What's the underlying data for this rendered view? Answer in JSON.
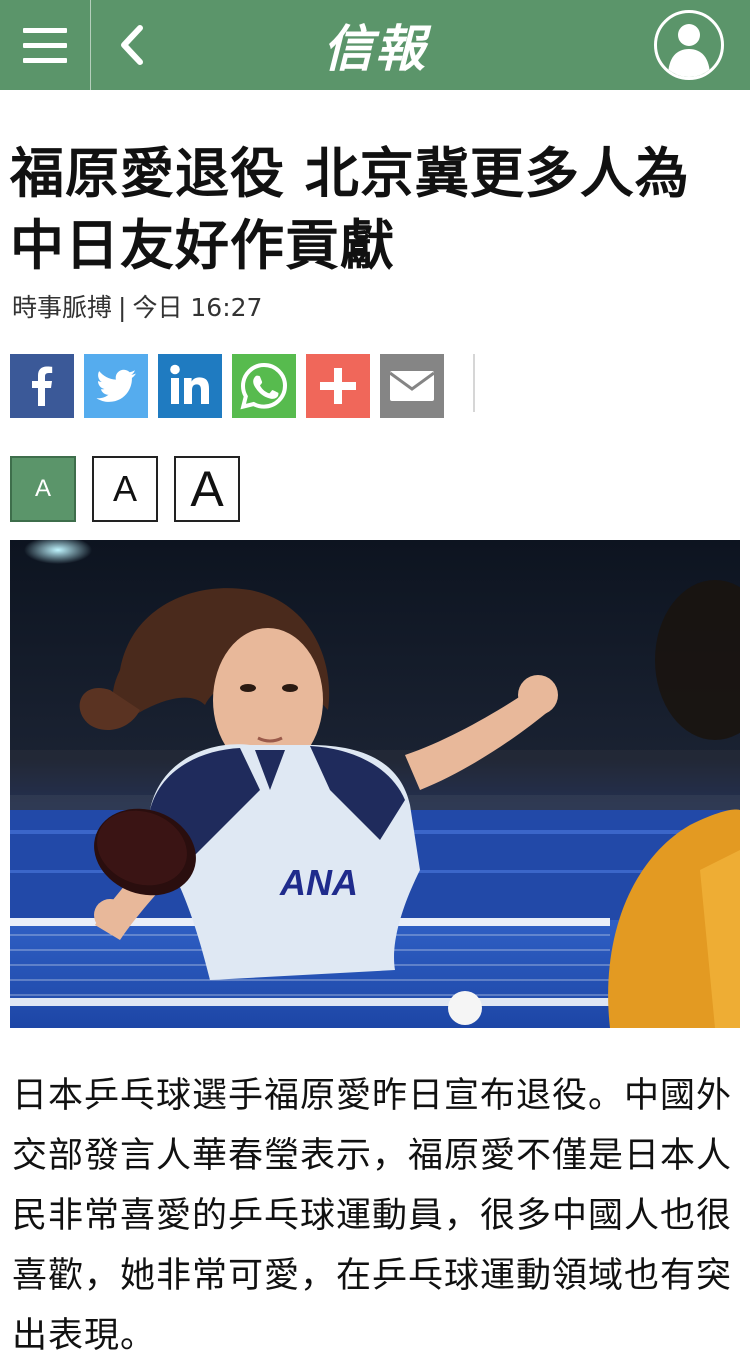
{
  "header": {
    "logo": "信報",
    "menu_icon": "hamburger-menu-icon",
    "back_icon": "chevron-left-icon",
    "profile_icon": "user-avatar-icon",
    "bg_color": "#5b956a"
  },
  "article": {
    "headline": "福原愛退役 北京冀更多人為中日友好作貢獻",
    "category": "時事脈搏",
    "separator": "|",
    "timestamp": "今日 16:27",
    "body": "日本乒乓球選手福原愛昨日宣布退役。中國外交部發言人華春瑩表示，福原愛不僅是日本人民非常喜愛的乒乓球運動員，很多中國人也很喜歡，她非常可愛，在乒乓球運動領域也有突出表現。"
  },
  "share": {
    "buttons": [
      {
        "name": "facebook",
        "icon": "facebook-icon",
        "color": "#3b5998"
      },
      {
        "name": "twitter",
        "icon": "twitter-icon",
        "color": "#55acee"
      },
      {
        "name": "linkedin",
        "icon": "linkedin-icon",
        "color": "#1f7bc1"
      },
      {
        "name": "whatsapp",
        "icon": "whatsapp-icon",
        "color": "#57bb4e"
      },
      {
        "name": "more",
        "icon": "plus-icon",
        "color": "#f0675a"
      },
      {
        "name": "email",
        "icon": "envelope-icon",
        "color": "#858585"
      }
    ]
  },
  "font_size": {
    "small": "A",
    "medium": "A",
    "large": "A",
    "active": "small",
    "active_color": "#5b956a"
  },
  "photo": {
    "jersey_text": "ANA",
    "subject": "table-tennis-player-photo"
  }
}
